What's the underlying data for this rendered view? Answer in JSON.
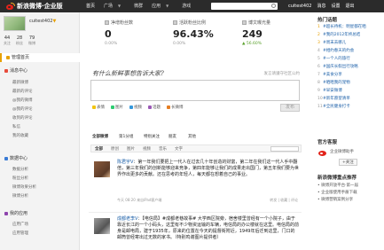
{
  "topbar": {
    "logo_text": "新浪微博·企业版",
    "nav": [
      "首页",
      "广场",
      "微群",
      "应用",
      "游戏"
    ],
    "user": [
      "cuitest402",
      "消息",
      "设置",
      "退出"
    ]
  },
  "sidebar": {
    "username": "cuitest402",
    "stats": [
      {
        "n": "44",
        "l": "关注"
      },
      {
        "n": "28",
        "l": "粉丝"
      },
      {
        "n": "79",
        "l": "微博"
      }
    ],
    "menu": {
      "home": "管理首页",
      "messages": "消息中心",
      "messages_sub": [
        "最新微博",
        "最新的评论",
        "@我的微博",
        "@我的评论",
        "收到的评论",
        "私信",
        "我的收藏"
      ],
      "data": "数据中心",
      "data_sub": [
        "数据分析",
        "粉丝分析",
        "微博效果分析",
        "微博分析"
      ],
      "apps": "我的应用",
      "apps_sub": [
        "应用广场",
        "应用管理"
      ]
    }
  },
  "metrics": [
    {
      "label": "净增粉丝数",
      "value": "0",
      "change": "0.00%",
      "positive": false
    },
    {
      "label": "活跃粉丝比例",
      "value": "96.43%",
      "change": "0.00%",
      "positive": false
    },
    {
      "label": "博文曝光量",
      "value": "249",
      "change": "▲ 56.60%",
      "positive": true
    }
  ],
  "compose": {
    "prompt": "有什么新鲜事想告诉大家?",
    "right_text": "发言请遵守社区公约",
    "tools": [
      "表情",
      "图片",
      "视频",
      "话题",
      "长微博"
    ],
    "publish": "发布"
  },
  "feed": {
    "tabs": [
      "全部微博",
      "第1分组",
      "特别关注",
      "朋友",
      "其他"
    ],
    "filters": [
      "全部",
      "原创",
      "图片",
      "视频",
      "音乐",
      "文字"
    ],
    "posts": [
      {
        "author": "陈君宇V",
        "text": "：第一年我们要把上一代人在过去几十年创造的财富，第二年在我们这一代人手中翻倍，第三年我们的创新能够迎来竞争，第四年能够让我们的成果走出国门，第五年我们要为世界作出更多的贡献。还在思考的年轻人，每天都在想着自己的事业。",
        "meta": "今天 08:20 来自iPad客户端",
        "actions": "转发 | 收藏 | 评论"
      },
      {
        "author": "成都老李V",
        "text": "：【电信局】#成都老巷故事# 大学西区院旁，宿舍楼里曾经有一个小院子，由于靠近长江的一个小码头，这里有不少物资运输的车辆，电信局的办公楼就在这里。电信局的前身是邮电局，建于1935年，原来的位置在今天的提督街附近，1949年后迁到这里，门口的邮筒曾经寄出过无数的家书。（特别鸣谢图片提供者）",
        "meta": "",
        "actions": ""
      }
    ]
  },
  "right": {
    "hot_title": "热门话题",
    "hot_topics": [
      "#超长待机：明星都在晒",
      "#我的2012年终总结",
      "#周末去哪儿",
      "#相约春天的约会",
      "#一个人的旅行",
      "#国庆长假出行攻略",
      "#美食分享",
      "#晒晒我的宠物",
      "#早安微博",
      "#新年愿望清单",
      "#全民健身打卡"
    ],
    "service_title": "官方客服",
    "service_name": "企业微博助手",
    "follow": "+关注",
    "news_title": "新浪微博重点推荐",
    "news_items": [
      "• 微博开放平台·第一届",
      "• 企业版使用手册下载",
      "• 微博营销案例分享"
    ]
  },
  "colors": {
    "topbar": "#2b2b2b",
    "accent": "#e7a000",
    "link": "#1b5fa8",
    "positive": "#5aa02c"
  }
}
